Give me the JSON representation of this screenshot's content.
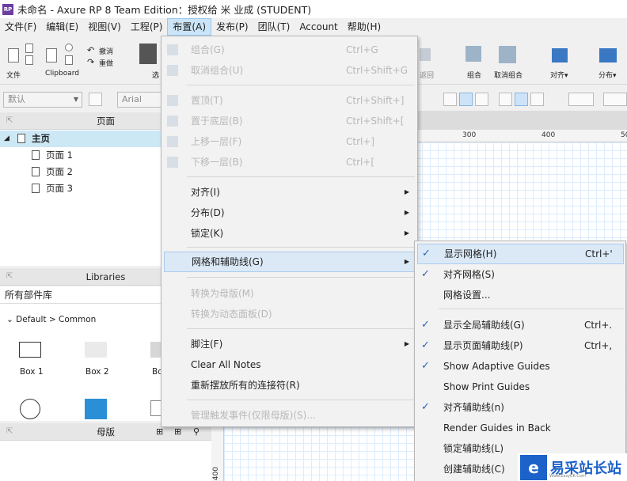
{
  "window": {
    "title": "未命名 - Axure RP 8 Team Edition：授权给 米 业成 (STUDENT)",
    "app_icon": "RP"
  },
  "menubar": [
    "文件(F)",
    "编辑(E)",
    "视图(V)",
    "工程(P)",
    "布置(A)",
    "发布(P)",
    "团队(T)",
    "Account",
    "帮助(H)"
  ],
  "toolbar": {
    "file": "文件",
    "clipboard": "Clipboard",
    "undo": "撤消",
    "redo": "重做",
    "select": "选",
    "return": "返回",
    "group": "组合",
    "ungroup": "取消组合",
    "align": "对齐▾",
    "distribute": "分布▾"
  },
  "format": {
    "style": "默认",
    "font": "Arial"
  },
  "pages": {
    "title": "页面",
    "items": [
      "主页",
      "页面 1",
      "页面 2",
      "页面 3"
    ]
  },
  "libraries": {
    "title": "Libraries",
    "selector": "所有部件库",
    "group": "Default > Common",
    "widgets": [
      "Box 1",
      "Box 2",
      "Bo"
    ]
  },
  "masters": {
    "title": "母版"
  },
  "ruler": {
    "top": [
      "300",
      "400",
      "50"
    ],
    "left": [
      "400"
    ]
  },
  "menu": {
    "items": [
      {
        "label": "组合(G)",
        "shortcut": "Ctrl+G",
        "disabled": true
      },
      {
        "label": "取消组合(U)",
        "shortcut": "Ctrl+Shift+G",
        "disabled": true
      },
      {
        "label": "置顶(T)",
        "shortcut": "Ctrl+Shift+]",
        "disabled": true
      },
      {
        "label": "置于底层(B)",
        "shortcut": "Ctrl+Shift+[",
        "disabled": true
      },
      {
        "label": "上移一层(F)",
        "shortcut": "Ctrl+]",
        "disabled": true
      },
      {
        "label": "下移一层(B)",
        "shortcut": "Ctrl+[",
        "disabled": true
      },
      {
        "label": "对齐(I)",
        "submenu": true
      },
      {
        "label": "分布(D)",
        "submenu": true
      },
      {
        "label": "锁定(K)",
        "submenu": true
      },
      {
        "label": "网格和辅助线(G)",
        "submenu": true,
        "highlighted": true
      },
      {
        "label": "转换为母版(M)",
        "disabled": true
      },
      {
        "label": "转换为动态面板(D)",
        "disabled": true
      },
      {
        "label": "脚注(F)",
        "submenu": true
      },
      {
        "label": "Clear All Notes"
      },
      {
        "label": "重新摆放所有的连接符(R)"
      },
      {
        "label": "管理触发事件(仅限母版)(S)...",
        "disabled": true
      }
    ]
  },
  "submenu": {
    "items": [
      {
        "label": "显示网格(H)",
        "shortcut": "Ctrl+'",
        "checked": true,
        "highlighted": true
      },
      {
        "label": "对齐网格(S)",
        "checked": true
      },
      {
        "label": "网格设置..."
      },
      {
        "label": "显示全局辅助线(G)",
        "shortcut": "Ctrl+.",
        "checked": true
      },
      {
        "label": "显示页面辅助线(P)",
        "shortcut": "Ctrl+,",
        "checked": true
      },
      {
        "label": "Show Adaptive Guides",
        "checked": true
      },
      {
        "label": "Show Print Guides"
      },
      {
        "label": "对齐辅助线(n)",
        "checked": true
      },
      {
        "label": "Render Guides in Back"
      },
      {
        "label": "锁定辅助线(L)"
      },
      {
        "label": "创建辅助线(C)"
      }
    ],
    "check_mark": "✓"
  },
  "watermark": {
    "text": "易采站长站",
    "url": "Www.EasyCK.Com"
  },
  "colors": {
    "accent": "#cce4f7",
    "check": "#2a63b8",
    "watermark": "#1c62c9"
  }
}
